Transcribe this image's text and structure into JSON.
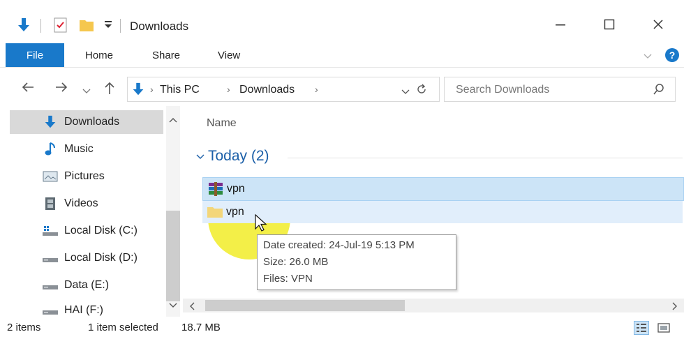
{
  "window": {
    "title": "Downloads",
    "controls": [
      "—",
      "☐",
      "✕"
    ]
  },
  "ribbon": {
    "tabs": [
      "File",
      "Home",
      "Share",
      "View"
    ]
  },
  "address": {
    "breadcrumb": [
      "This PC",
      "Downloads"
    ],
    "search_placeholder": "Search Downloads"
  },
  "nav": {
    "items": [
      {
        "label": "Downloads",
        "icon": "download-arrow-icon",
        "selected": true
      },
      {
        "label": "Music",
        "icon": "music-note-icon"
      },
      {
        "label": "Pictures",
        "icon": "pictures-icon"
      },
      {
        "label": "Videos",
        "icon": "videos-icon"
      },
      {
        "label": "Local Disk (C:)",
        "icon": "windows-drive-icon"
      },
      {
        "label": "Local Disk (D:)",
        "icon": "drive-icon"
      },
      {
        "label": "Data (E:)",
        "icon": "drive-icon"
      },
      {
        "label": "HAI (F:)",
        "icon": "drive-icon"
      }
    ]
  },
  "filelist": {
    "column_name": "Name",
    "group_label": "Today (2)",
    "files": [
      {
        "name": "vpn",
        "icon": "winrar-archive-icon",
        "selected": true
      },
      {
        "name": "vpn",
        "icon": "folder-icon",
        "hover": true
      }
    ]
  },
  "tooltip": {
    "lines": [
      "Date created: 24-Jul-19 5:13 PM",
      "Size: 26.0 MB",
      "Files: VPN"
    ]
  },
  "status": {
    "item_count": "2 items",
    "selection": "1 item selected",
    "size": "18.7 MB"
  },
  "colors": {
    "accent": "#1979ca",
    "selection": "#cce4f7",
    "group_header": "#1b5fa8",
    "cursor_highlight": "#f0eb14"
  }
}
